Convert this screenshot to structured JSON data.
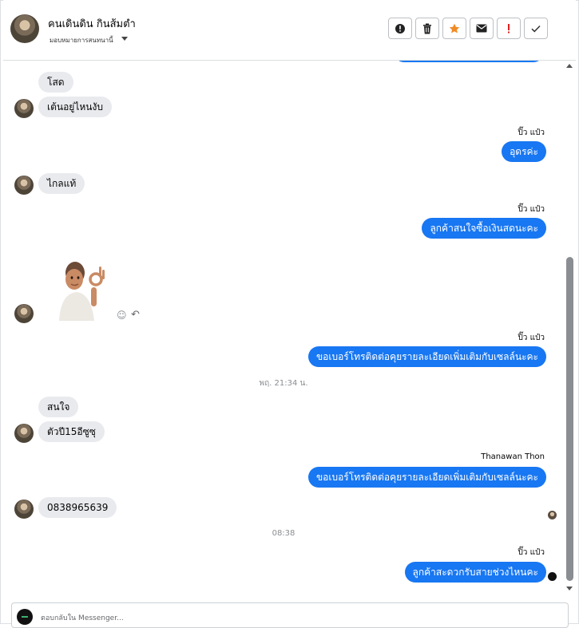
{
  "header": {
    "name": "คนเดินดิน กินส้มตำ",
    "subtitle": "มอบหมายการสนทนานี้",
    "actions": [
      {
        "icon": "alert-circle-icon",
        "label": "!"
      },
      {
        "icon": "trash-icon"
      },
      {
        "icon": "star-icon"
      },
      {
        "icon": "envelope-icon"
      },
      {
        "icon": "exclamation-icon",
        "label": "!"
      },
      {
        "icon": "check-icon"
      }
    ]
  },
  "messages": {
    "m1": "โสด",
    "m2": "เต้นอยู่ไหนงับ",
    "s1": "ปิ๊ว แป๋ว",
    "o1": "อุดรค่ะ",
    "m3": "ไกลแท้",
    "s2": "ปิ๊ว แป๋ว",
    "o2": "ลูกค้าสนใจซื้อเงินสดนะคะ",
    "s3": "ปิ๊ว แป๋ว",
    "o3": "ขอเบอร์โทรติดต่อคุยรายละเอียดเพิ่มเติมกับเซลล์นะคะ",
    "t1": "พฤ. 21:34 น.",
    "m4": "สนใจ",
    "m5": "ตัวปี15อีซูซุ",
    "s4": "Thanawan Thon",
    "o4": "ขอเบอร์โทรติดต่อคุยรายละเอียดเพิ่มเติมกับเซลล์นะคะ",
    "m6": "0838965639",
    "t2": "08:38",
    "s5": "ปิ๊ว แป๋ว",
    "o5": "ลูกค้าสะดวกรับสายช่วงไหนคะ"
  },
  "composer": {
    "placeholder": "ตอบกลับใน Messenger..."
  },
  "colors": {
    "outgoing": "#1877f2",
    "incoming": "#e9eaee",
    "star": "#f08a24",
    "alert": "#e02020"
  }
}
